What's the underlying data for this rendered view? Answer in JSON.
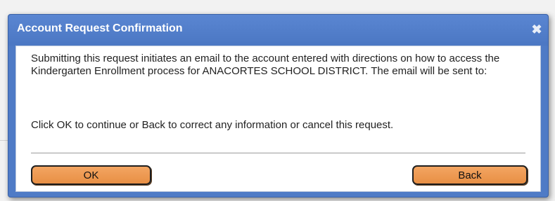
{
  "dialog": {
    "title": "Account Request Confirmation",
    "close_symbol": "✖",
    "message_line_1": "Submitting this request initiates an email to the account entered with directions on how to access the Kindergarten Enrollment process for ANACORTES SCHOOL DISTRICT. The email will be sent to:",
    "message_line_2": "Click OK to continue or Back to correct any information or cancel this request.",
    "ok_label": "OK",
    "back_label": "Back"
  },
  "colors": {
    "titlebar": "#4f7bc6",
    "button": "#e88f44",
    "body_bg": "#ffffff"
  },
  "icons": {
    "close": "close-icon"
  }
}
